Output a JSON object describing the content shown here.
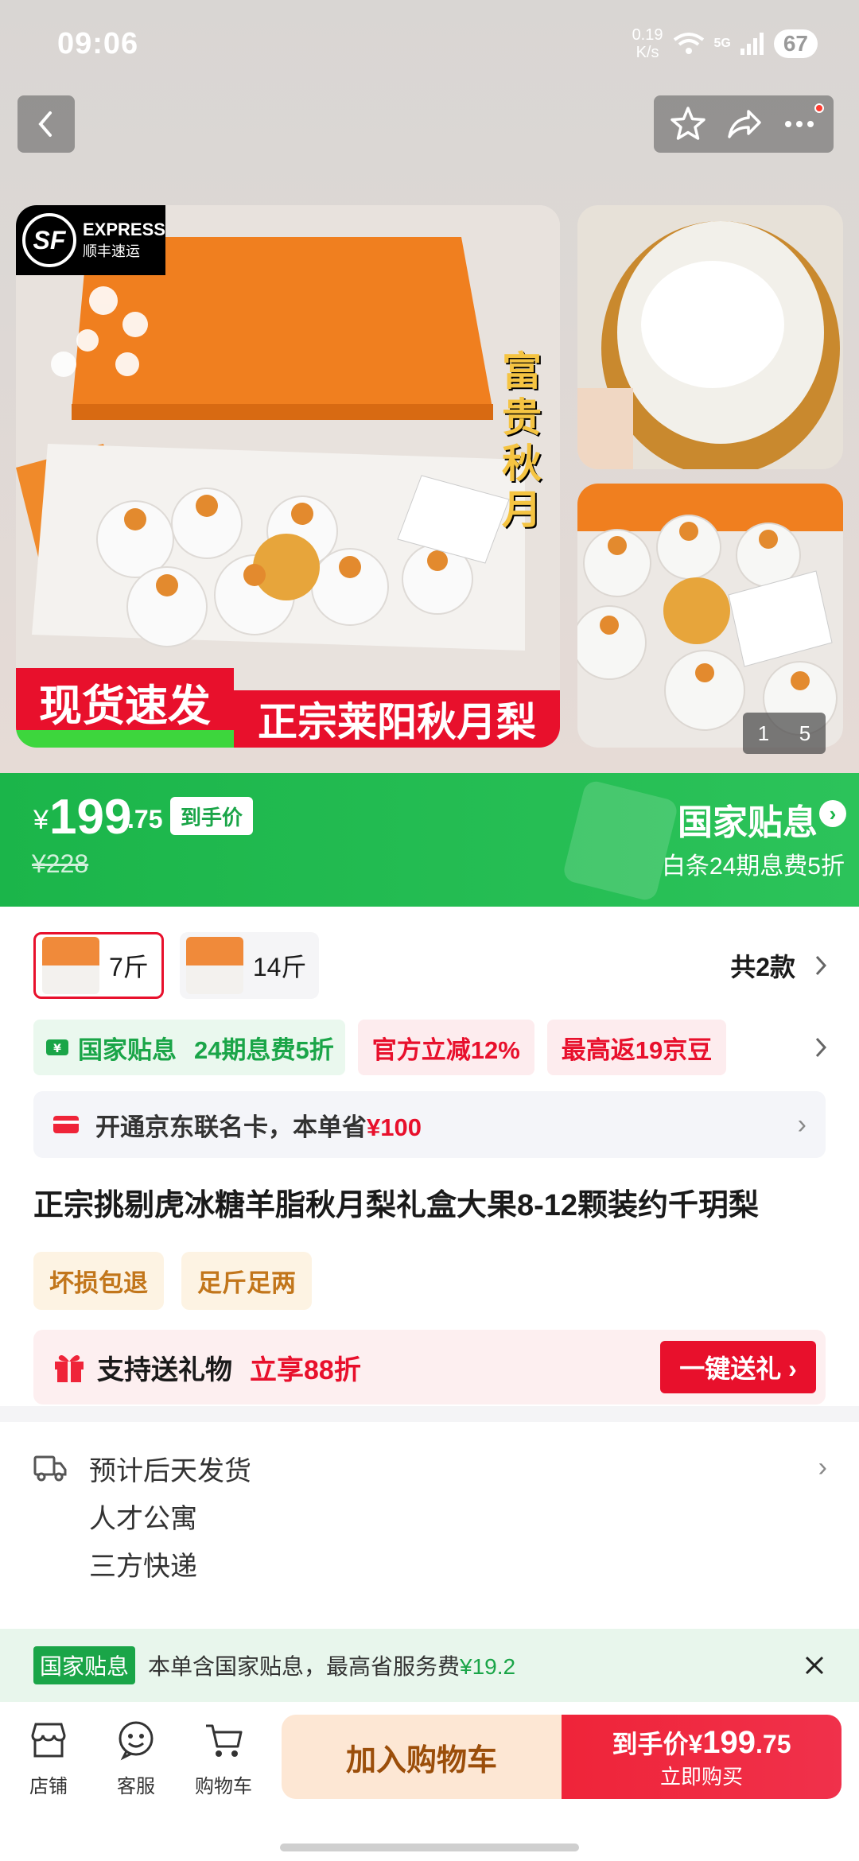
{
  "status_bar": {
    "time": "09:06",
    "speed_value": "0.19",
    "speed_unit": "K/s",
    "network": "5G",
    "battery": "67"
  },
  "gallery": {
    "sf_badge": {
      "title": "EXPRESS",
      "subtitle": "顺丰速运",
      "logo": "SF"
    },
    "vertical_text": "富贵秋月",
    "promo_left": "现货速发",
    "promo_right": "正宗莱阳秋月梨",
    "pager_current": "1",
    "pager_total": "5"
  },
  "price": {
    "currency": "¥",
    "integer": "199",
    "decimal": ".75",
    "tag": "到手价",
    "original": "¥228",
    "subsidy_label": "国家贴息",
    "subsidy_arrow": "›",
    "baitiao": "白条24期息费5折"
  },
  "variants": {
    "items": [
      {
        "label": "7斤",
        "selected": true
      },
      {
        "label": "14斤",
        "selected": false
      }
    ],
    "count_label": "共2款"
  },
  "promotions": {
    "subsidy": "国家贴息",
    "installment": "24期息费5折",
    "discount": "官方立减12%",
    "cashback": "最高返19京豆"
  },
  "card_offer": {
    "text": "开通京东联名卡，本单省",
    "amount": "¥100"
  },
  "product": {
    "title": "正宗挑剔虎冰糖羊脂秋月梨礼盒大果8-12颗装约千玥梨",
    "tags": [
      "坏损包退",
      "足斤足两"
    ]
  },
  "gift": {
    "title": "支持送礼物",
    "discount": "立享88折",
    "button": "一键送礼 ›"
  },
  "shipping": {
    "eta": "预计后天发货",
    "address": "人才公寓",
    "carrier": "三方快递"
  },
  "notice": {
    "badge": "国家贴息",
    "text": "本单含国家贴息，最高省服务费",
    "amount": "¥19.2"
  },
  "bottom_bar": {
    "shop": "店铺",
    "service": "客服",
    "cart": "购物车",
    "add_to_cart": "加入购物车",
    "buy_price_prefix": "到手价¥",
    "buy_price_int": "199",
    "buy_price_dec": ".75",
    "buy_now": "立即购买"
  },
  "colors": {
    "brand_red": "#e8102c",
    "subsidy_green": "#1bb54a",
    "tag_orange": "#c2761b"
  }
}
